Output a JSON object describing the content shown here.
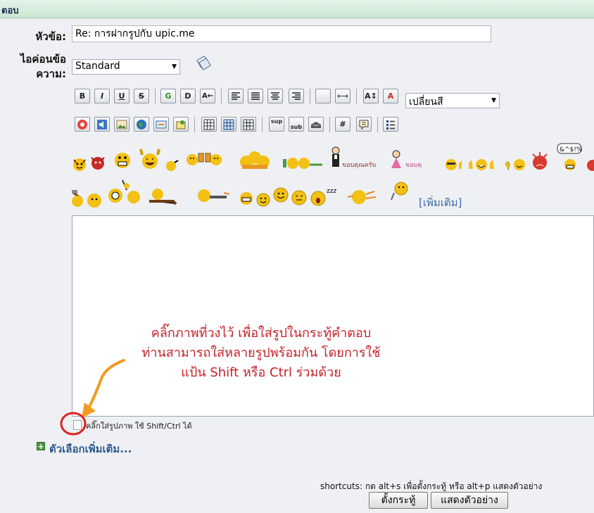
{
  "header": {
    "title": "ตอบ"
  },
  "form": {
    "subject_label": "หัวข้อ:",
    "subject_value": "Re: การฝากรูปกับ upic.me",
    "icon_label_line1": "ไอค่อนข้อ",
    "icon_label_line2": "ความ:",
    "icon_select_value": "Standard",
    "color_select_value": "เปลี่ยนสี"
  },
  "toolbar": {
    "row1": [
      "B",
      "I",
      "U",
      "S",
      "G",
      "D",
      "A←",
      "align-left",
      "align-center-left",
      "align-center",
      "align-right",
      "hr",
      "⟷",
      "A↕",
      "A"
    ],
    "row2": [
      "flash",
      "media",
      "image",
      "globe",
      "link",
      "popup",
      "table1",
      "table2",
      "table3",
      "sup",
      "sub",
      "email",
      "#",
      "quote",
      "list"
    ]
  },
  "smileys": {
    "more_link": "[เพิ่มเติม]",
    "thank_you_label": "ขอบคุณครับ",
    "bow_label": "ขอบคุ"
  },
  "editor": {
    "note_line1": "คลิ๊กภาพที่วงไว้ เพื่อใส่รูปในกระทู้คำตอบ",
    "note_line2": "ท่านสามารถใส่หลายรูปพร้อมกัน โดยการใช้",
    "note_line3": "แป้น Shift หรือ Ctrl ร่วมด้วย",
    "attach_text": "คลิ๊กใส่รูปภาพ ใช้ Shift/Ctrl ได้"
  },
  "options": {
    "more_options": "ตัวเลือกเพิ่มเติม..."
  },
  "footer": {
    "shortcuts": "shortcuts: กด alt+s เพื่อตั้งกระทู้ หรือ alt+p แสดงตัวอย่าง",
    "post_button": "ตั้งกระทู้",
    "preview_button": "แสดงตัวอย่าง"
  },
  "colors": {
    "note_red": "#c4222a",
    "arrow_orange": "#f39a1e",
    "circle_red": "#e02020"
  }
}
